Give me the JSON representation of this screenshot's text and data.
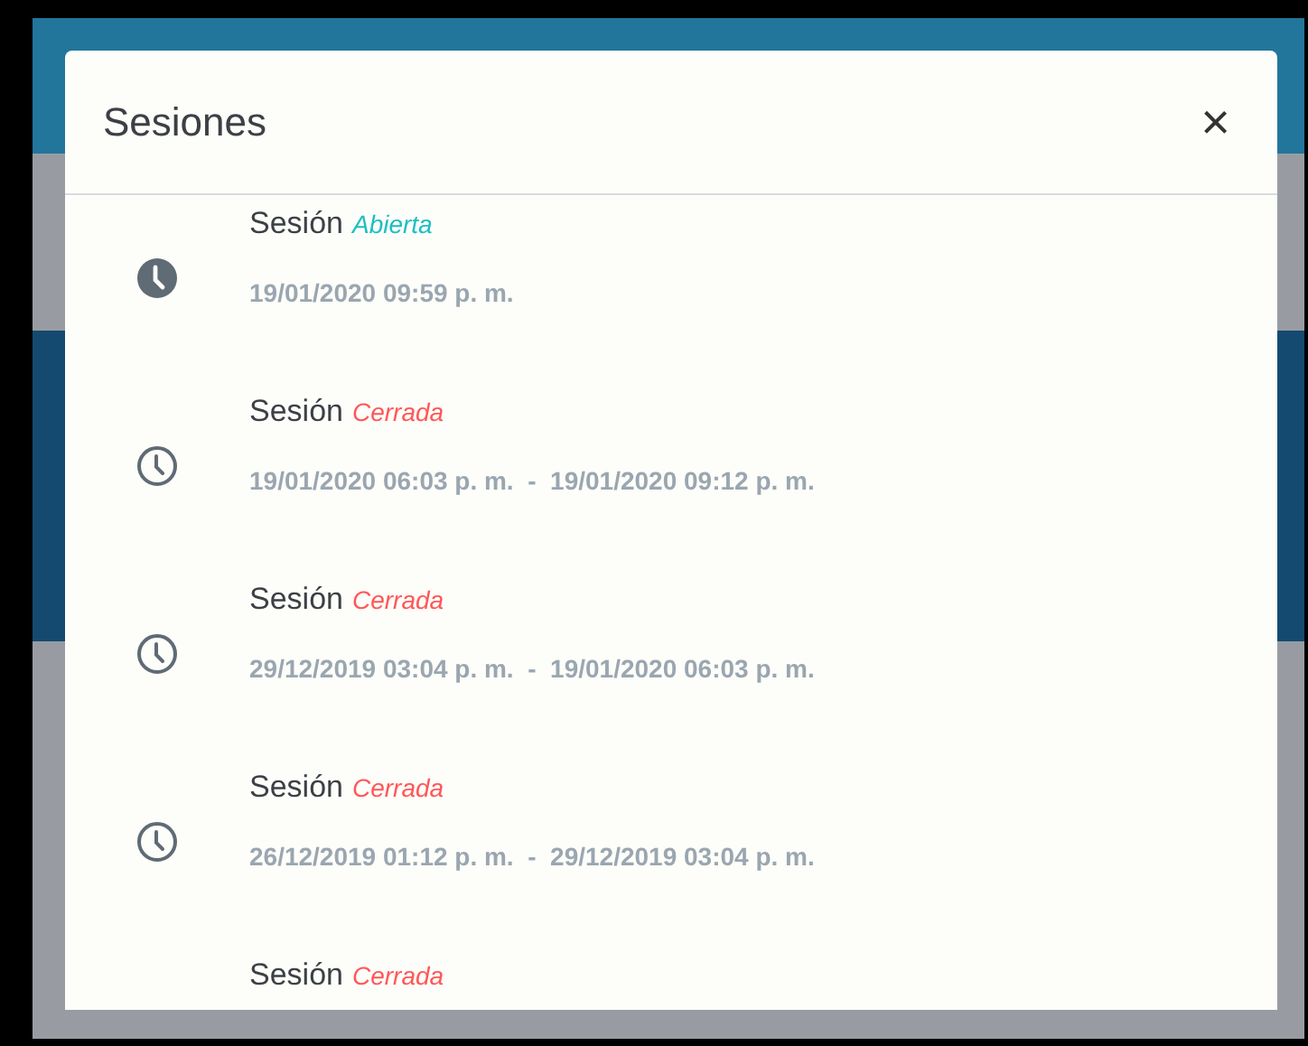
{
  "dialog": {
    "title": "Sesiones",
    "close": "×"
  },
  "sessions": [
    {
      "kind": "open",
      "label": "Sesión",
      "status": "Abierta",
      "dates": "19/01/2020 09:59 p. m."
    },
    {
      "kind": "closed",
      "label": "Sesión",
      "status": "Cerrada",
      "dates": "19/01/2020 06:03 p. m.  -  19/01/2020 09:12 p. m."
    },
    {
      "kind": "closed",
      "label": "Sesión",
      "status": "Cerrada",
      "dates": "29/12/2019 03:04 p. m.  -  19/01/2020 06:03 p. m."
    },
    {
      "kind": "closed",
      "label": "Sesión",
      "status": "Cerrada",
      "dates": "26/12/2019 01:12 p. m.  -  29/12/2019 03:04 p. m."
    },
    {
      "kind": "closed",
      "label": "Sesión",
      "status": "Cerrada"
    }
  ]
}
